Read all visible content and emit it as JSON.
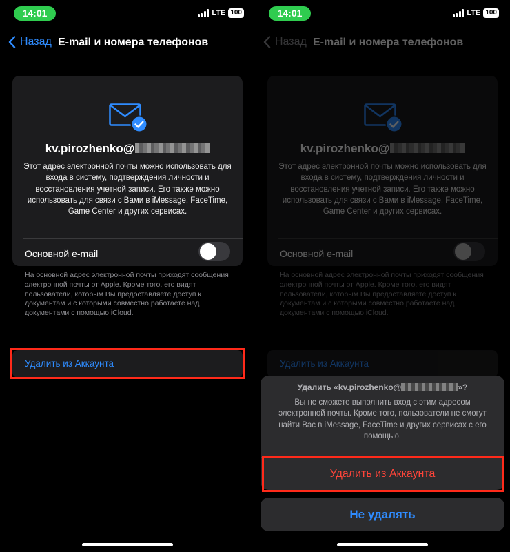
{
  "status_bar": {
    "time": "14:01",
    "network": "LTE",
    "battery": "100"
  },
  "nav": {
    "back_label": "Назад",
    "title": "E-mail и номера телефонов"
  },
  "card": {
    "icon": "envelope-check-icon",
    "email_user": "kv.pirozhenko@",
    "description": "Этот адрес электронной почты можно использовать для входа в систему, подтверждения личности и восстановления учетной записи. Его также можно использовать для связи с Вами в iMessage, FaceTime, Game Center и других сервисах.",
    "toggle_label": "Основной e-mail",
    "toggle_on": false
  },
  "footnote": "На основной адрес электронной почты приходят сообщения электронной почты от Apple. Кроме того, его видят пользователи, которым Вы предоставляете доступ к документам и с которыми совместно работаете над документами с помощью iCloud.",
  "delete_row_label": "Удалить из Аккаунта",
  "action_sheet": {
    "title_prefix": "Удалить «kv.pirozhenko@",
    "title_suffix": "»?",
    "message": "Вы не сможете выполнить вход с этим адресом электронной почты. Кроме того, пользователи не смогут найти Вас в iMessage, FaceTime и других сервисах с его помощью.",
    "delete_label": "Удалить из Аккаунта",
    "cancel_label": "Не удалять"
  },
  "colors": {
    "accent": "#2f8cff",
    "destructive": "#ff453a",
    "highlight": "#ff2a1a",
    "status_pill": "#2fcc4f"
  }
}
